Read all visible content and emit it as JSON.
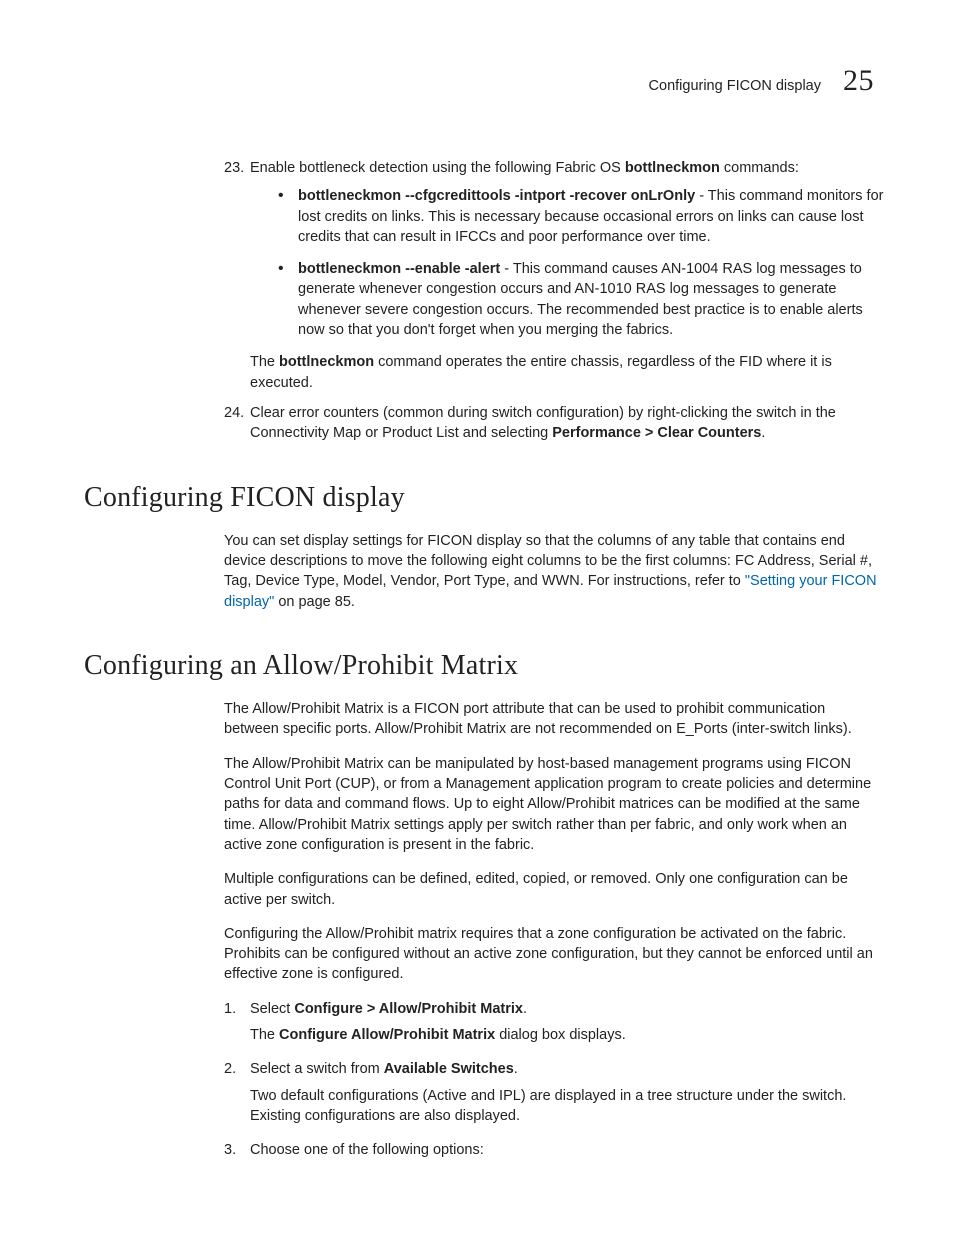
{
  "header": {
    "title": "Configuring FICON display",
    "page_number": "25"
  },
  "s23": {
    "num": "23.",
    "lead_a": "Enable bottleneck detection using the following Fabric OS ",
    "lead_b": "bottlneckmon",
    "lead_c": " commands:",
    "b1": {
      "cmd": "bottleneckmon --cfgcredittools -intport -recover onLrOnly",
      "rest": " - This command monitors for lost credits on links. This is necessary because occasional errors on links can cause lost credits that can result in IFCCs and poor performance over time."
    },
    "b2": {
      "cmd": "bottleneckmon --enable -alert",
      "rest": " - This command causes AN-1004 RAS log messages to generate whenever congestion occurs and AN-1010 RAS log messages to generate whenever severe congestion occurs. The recommended best practice is to enable alerts now so that you don't forget when you merging the fabrics."
    },
    "note_a": "The ",
    "note_b": "bottlneckmon",
    "note_c": " command operates the entire chassis, regardless of the FID where it is executed."
  },
  "s24": {
    "num": "24.",
    "a": "Clear error counters (common during switch configuration) by right-clicking the switch in the Connectivity Map or Product List and selecting ",
    "b": "Performance > Clear Counters",
    "c": "."
  },
  "sec1": {
    "title": "Configuring FICON display",
    "p_a": "You can set display settings for FICON display so that the columns of any table that contains end device descriptions to move the following eight columns to be the first columns: FC Address, Serial #, Tag, Device Type, Model, Vendor, Port Type, and WWN. For instructions, refer to ",
    "p_link": "\"Setting your FICON display\"",
    "p_b": " on page 85."
  },
  "sec2": {
    "title": "Configuring an Allow/Prohibit Matrix",
    "p1": "The Allow/Prohibit Matrix is a FICON port attribute that can be used to prohibit communication between specific ports. Allow/Prohibit Matrix are not recommended on E_Ports (inter-switch links).",
    "p2": "The Allow/Prohibit Matrix can be manipulated by host-based management programs using FICON Control Unit Port (CUP), or from a Management application program to create policies and determine paths for data and command flows. Up to eight Allow/Prohibit matrices can be modified at the same time. Allow/Prohibit Matrix settings apply per switch rather than per fabric, and only work when an active zone configuration is present in the fabric.",
    "p3": "Multiple configurations can be defined, edited, copied, or removed. Only one configuration can be active per switch.",
    "p4": "Configuring the Allow/Prohibit matrix requires that a zone configuration be activated on the fabric. Prohibits can be configured without an active zone configuration, but they cannot be enforced until an effective zone is configured.",
    "step1": {
      "num": "1.",
      "a": "Select ",
      "b": "Configure > Allow/Prohibit Matrix",
      "c": ".",
      "sub_a": "The ",
      "sub_b": "Configure Allow/Prohibit Matrix",
      "sub_c": " dialog box displays."
    },
    "step2": {
      "num": "2.",
      "a": "Select a switch from ",
      "b": "Available Switches",
      "c": ".",
      "sub": "Two default configurations (Active and IPL) are displayed in a tree structure under the switch. Existing configurations are also displayed."
    },
    "step3": {
      "num": "3.",
      "a": "Choose one of the following options:"
    }
  }
}
